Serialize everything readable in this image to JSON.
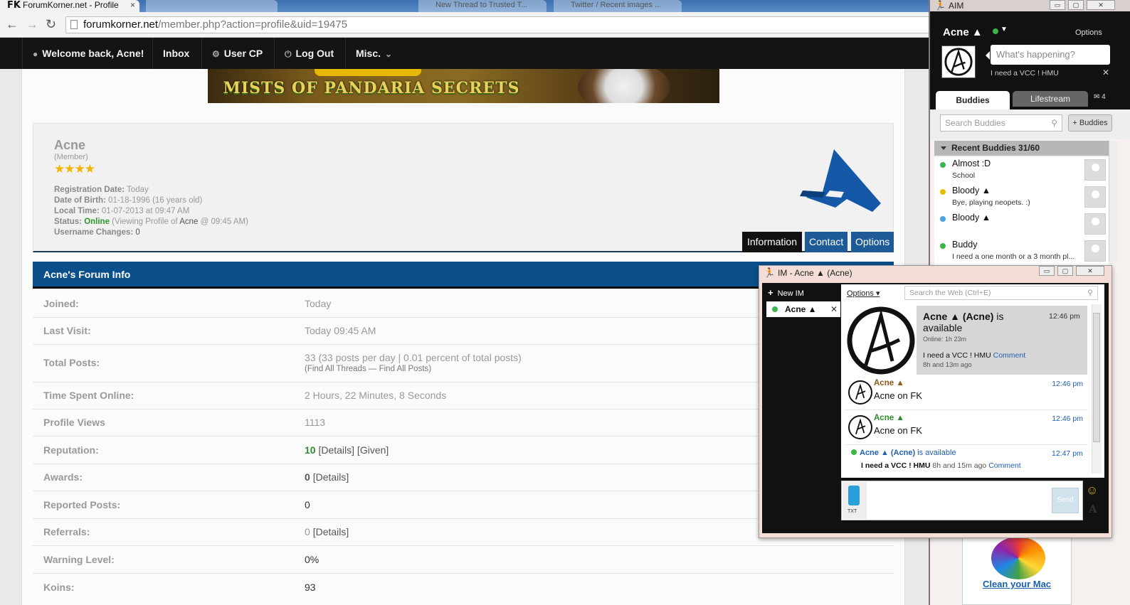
{
  "browser": {
    "tab_title": "ForumKorner.net - Profile",
    "tab_logo": "FK",
    "tab_close": "×",
    "ghost_tabs": [
      "New Thread to Trusted T...",
      "Twitter / Recent images ..."
    ],
    "url_host": "forumkorner.net",
    "url_path": "/member.php?action=profile&uid=19475",
    "icons": [
      "back-arrow-icon",
      "forward-arrow-icon",
      "reload-icon",
      "page-icon"
    ]
  },
  "forum_nav": {
    "items": [
      {
        "label": "Welcome back, Acne!",
        "icon": "user-icon"
      },
      {
        "label": "Inbox",
        "icon": ""
      },
      {
        "label": "User CP",
        "icon": "gear-icon"
      },
      {
        "label": "Log Out",
        "icon": "power-icon"
      },
      {
        "label": "Misc.",
        "icon": "chevron-down-icon"
      }
    ]
  },
  "banner": {
    "text": "MISTS OF PANDARIA SECRETS"
  },
  "profile": {
    "name": "Acne",
    "rank": "(Member)",
    "stars": "★★★★",
    "registration_label": "Registration Date:",
    "registration_value": "Today",
    "dob_label": "Date of Birth:",
    "dob_value": "01-18-1996 (16 years old)",
    "localtime_label": "Local Time:",
    "localtime_value": "01-07-2013 at 09:47 AM",
    "status_label": "Status:",
    "status_value": "Online",
    "status_viewing_pre": "(Viewing Profile of",
    "status_viewing_user": "Acne",
    "status_viewing_post": "@ 09:45 AM)",
    "username_changes_label": "Username Changes:",
    "username_changes_value": "0",
    "tabs": [
      "Information",
      "Contact",
      "Options"
    ]
  },
  "forum_info": {
    "header": "Acne's Forum Info",
    "rows": [
      {
        "label": "Joined:",
        "value": "Today"
      },
      {
        "label": "Last Visit:",
        "value": "Today 09:45 AM"
      },
      {
        "label": "Total Posts:",
        "value": "33 (33 posts per day | 0.01 percent of total posts)",
        "sub": "(Find All Threads — Find All Posts)"
      },
      {
        "label": "Time Spent Online:",
        "value": "2 Hours, 22 Minutes, 8 Seconds"
      },
      {
        "label": "Profile Views",
        "value": "1113"
      },
      {
        "label": "Reputation:",
        "value_num": "10",
        "value_rest": "[Details] [Given]"
      },
      {
        "label": "Awards:",
        "value_num": "0",
        "value_rest": "[Details]"
      },
      {
        "label": "Reported Posts:",
        "value": "0"
      },
      {
        "label": "Referrals:",
        "value_num": "0",
        "value_rest": "[Details]"
      },
      {
        "label": "Warning Level:",
        "value": "0%"
      },
      {
        "label": "Koins:",
        "value": "93"
      }
    ]
  },
  "aim": {
    "title": "AIM",
    "window_buttons": [
      "▭",
      "▢",
      "✕"
    ],
    "screen_name": "Acne ▲",
    "options": "Options",
    "status_placeholder": "What's happening?",
    "status_message": "I need a VCC ! HMU",
    "status_close": "✕",
    "tabs": {
      "buddies": "Buddies",
      "lifestream": "Lifestream"
    },
    "mail_count": "4",
    "search_placeholder": "Search Buddies",
    "add_buddies": "+ Buddies",
    "group": "Recent Buddies 31/60",
    "buddies": [
      {
        "name": "Almost :D",
        "status": "School",
        "dot": "#3cb54a"
      },
      {
        "name": "Bloody ▲",
        "status": "Bye, playing neopets. :)",
        "dot": "#e0c000"
      },
      {
        "name": "Bloody ▲",
        "status": "",
        "dot": "#4aa3e0"
      },
      {
        "name": "Buddy",
        "status": "I need a one month or a 3 month pl...",
        "dot": "#3cb54a"
      }
    ],
    "ad_text": "Clean your Mac"
  },
  "im": {
    "title": "IM - Acne ▲ (Acne)",
    "window_buttons": [
      "▭",
      "▢",
      "✕"
    ],
    "new_im": "New IM",
    "session_name": "Acne ▲",
    "options": "Options",
    "search_placeholder": "Search the Web     (Ctrl+E)",
    "card": {
      "name_bold": "Acne ▲ (Acne)",
      "name_rest": "is available",
      "time": "12:46 pm",
      "online": "Online: 1h 23m",
      "message": "I need a VCC ! HMU",
      "comment": "Comment",
      "ago": "8h and 13m ago"
    },
    "messages": [
      {
        "who": "Acne ▲",
        "text": "Acne on FK",
        "time": "12:46 pm",
        "color": "#8a5a1a"
      },
      {
        "who": "Acne ▲",
        "text": "Acne on FK",
        "time": "12:46 pm",
        "color": "#2e8a2e"
      }
    ],
    "avail": {
      "name": "Acne ▲ (Acne)",
      "text": "is available",
      "time": "12:47 pm",
      "message": "I need a VCC ! HMU",
      "ago": "8h and 15m ago",
      "comment": "Comment"
    },
    "phone_label": "TXT",
    "send": "Send"
  }
}
